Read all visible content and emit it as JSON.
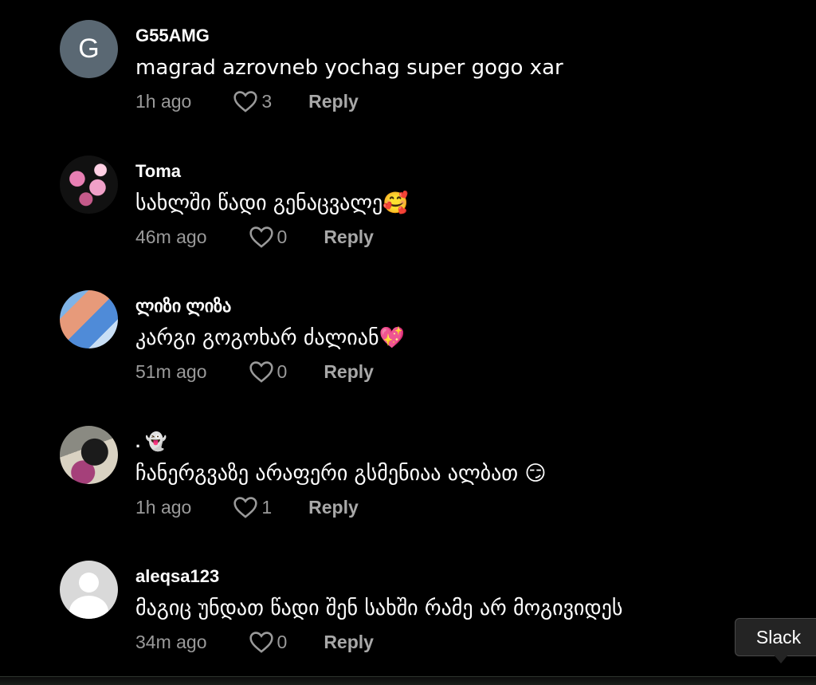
{
  "comments": [
    {
      "username": "G55AMG",
      "avatar_letter": "G",
      "text": "magrad azrovneb yochag super gogo xar",
      "time": "1h ago",
      "likes": "3",
      "reply_label": "Reply"
    },
    {
      "username": "Toma",
      "text": "სახლში წადი გენაცვალე🥰",
      "time": "46m ago",
      "likes": "0",
      "reply_label": "Reply"
    },
    {
      "username": "ლიზი ლიზა",
      "text": "კარგი გოგოხარ ძალიან💖",
      "time": "51m ago",
      "likes": "0",
      "reply_label": "Reply"
    },
    {
      "username": ". 👻",
      "text": "ჩანერგვაზე არაფერი გსმენიაა ალბათ 😏",
      "time": "1h ago",
      "likes": "1",
      "reply_label": "Reply"
    },
    {
      "username": "aleqsa123",
      "text": "მაგიც უნდათ წადი შენ სახში რამე არ მოგივიდეს",
      "time": "34m ago",
      "likes": "0",
      "reply_label": "Reply"
    }
  ],
  "tooltip": {
    "label": "Slack"
  },
  "icons": {
    "like": "heart-icon",
    "avatar_default": "person-icon"
  }
}
